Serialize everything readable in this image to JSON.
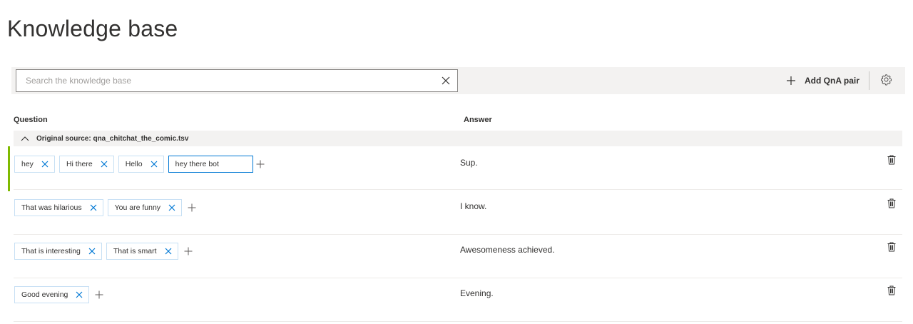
{
  "page": {
    "title": "Knowledge base"
  },
  "search": {
    "placeholder": "Search the knowledge base",
    "value": ""
  },
  "toolbar": {
    "add_label": "Add QnA pair"
  },
  "columns": {
    "question": "Question",
    "answer": "Answer"
  },
  "group": {
    "label": "Original source: qna_chitchat_the_comic.tsv"
  },
  "rows": [
    {
      "questions": [
        "hey",
        "Hi there",
        "Hello"
      ],
      "editing_value": "hey there bot",
      "answer": "Sup."
    },
    {
      "questions": [
        "That was hilarious",
        "You are funny"
      ],
      "answer": "I know."
    },
    {
      "questions": [
        "That is interesting",
        "That is smart"
      ],
      "answer": "Awesomeness achieved."
    },
    {
      "questions": [
        "Good evening"
      ],
      "answer": "Evening."
    }
  ],
  "colors": {
    "accent": "#0078d4",
    "active_row": "#7fba00",
    "chip_border": "#c7e0f4",
    "toolbar_bg": "#f3f2f1"
  },
  "icons": [
    "close-icon",
    "add-icon",
    "settings-icon",
    "chevron-up-icon",
    "delete-icon"
  ]
}
